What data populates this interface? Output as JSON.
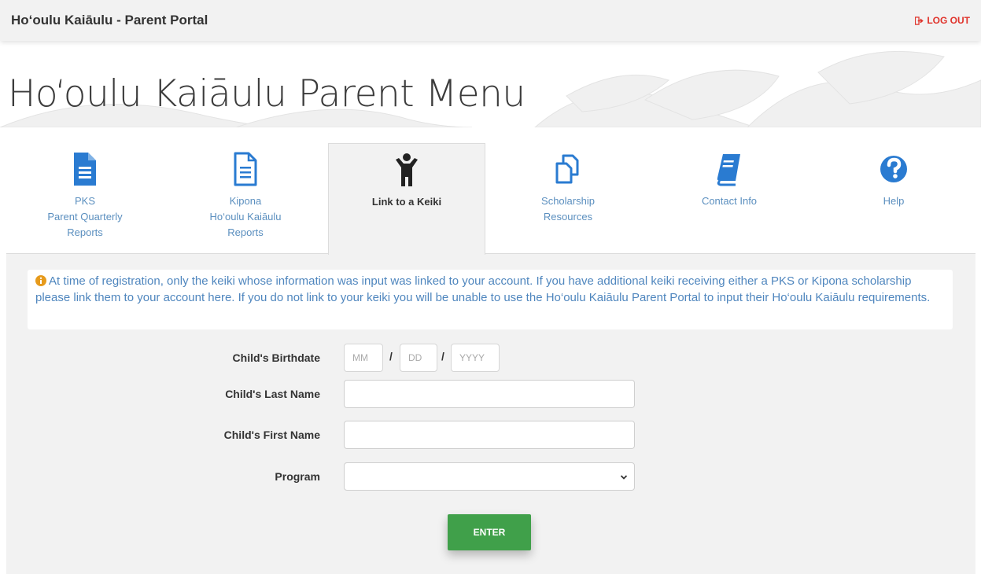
{
  "header": {
    "title": "Ho‘oulu Kaiāulu - Parent Portal",
    "logout_label": "LOG OUT"
  },
  "page": {
    "title": "Ho‘oulu Kaiāulu Parent Menu"
  },
  "tabs": [
    {
      "line1": "PKS",
      "line2": "Parent Quarterly",
      "line3": "Reports",
      "icon": "document-filled-icon"
    },
    {
      "line1": "Kipona",
      "line2": "Ho‘oulu Kaiāulu",
      "line3": "Reports",
      "icon": "document-outline-icon"
    },
    {
      "line1": "Link to a Keiki",
      "icon": "child-icon",
      "active": true
    },
    {
      "line1": "Scholarship",
      "line2": "Resources",
      "icon": "copy-icon"
    },
    {
      "line1": "Contact Info",
      "icon": "book-icon"
    },
    {
      "line1": "Help",
      "icon": "question-circle-icon"
    }
  ],
  "alert": {
    "text": "At time of registration, only the keiki whose information was input was linked to your account. If you have additional keiki receiving either a PKS or Kipona scholarship please link them to your account here. If you do not link to your keiki you will be unable to use the Ho‘oulu Kaiāulu Parent Portal to input their Ho‘oulu Kaiāulu requirements."
  },
  "form": {
    "birthdate_label": "Child's Birthdate",
    "mm_placeholder": "MM",
    "dd_placeholder": "DD",
    "yyyy_placeholder": "YYYY",
    "date_separator": "/",
    "last_name_label": "Child's Last Name",
    "last_name_value": "",
    "first_name_label": "Child's First Name",
    "first_name_value": "",
    "program_label": "Program",
    "program_value": "",
    "submit_label": "ENTER"
  },
  "colors": {
    "accent_blue": "#2a7bd1",
    "logout_red": "#e0332b",
    "enter_green": "#40a04a",
    "link_blue": "#5b8fbf",
    "alert_text": "#4f86be",
    "info_orange": "#e69a1c"
  }
}
